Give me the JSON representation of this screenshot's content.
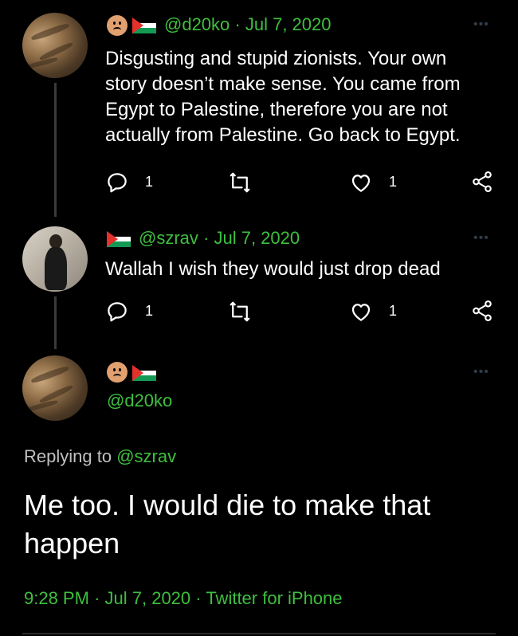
{
  "tweets": [
    {
      "handle": "@d20ko",
      "sep": "·",
      "date": "Jul 7, 2020",
      "text": "Disgusting and stupid zionists. Your own story doesn’t make sense. You came from Egypt to Palestine, therefore you are not actually from Palestine. Go back to Egypt.",
      "reply_count": "1",
      "like_count": "1",
      "avatar": "cat-avatar",
      "emoji": "frowning-face-emoji"
    },
    {
      "handle": "@szrav",
      "sep": "·",
      "date": "Jul 7, 2020",
      "text": "Wallah I wish they would just drop dead",
      "reply_count": "1",
      "like_count": "1",
      "avatar": "person-avatar"
    }
  ],
  "main_tweet": {
    "handle": "@d20ko",
    "replying_prefix": "Replying to",
    "replying_to": "@szrav",
    "text": "Me too. I would die to make that happen",
    "time": "9:28 PM",
    "sep1": "·",
    "date": "Jul 7, 2020",
    "sep2": "·",
    "source": "Twitter for iPhone"
  },
  "more_glyph": "•••",
  "icons": [
    "reply-icon",
    "retweet-icon",
    "like-icon",
    "share-icon",
    "flag-palestine-icon"
  ],
  "colors": {
    "accent": "#3fbf3f",
    "background": "#000000",
    "text": "#ffffff"
  }
}
